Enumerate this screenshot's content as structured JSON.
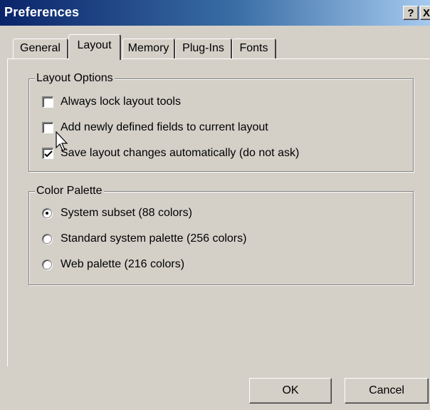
{
  "window": {
    "title": "Preferences",
    "help_button": "?",
    "close_button": "X"
  },
  "tabs": [
    {
      "label": "General",
      "active": false
    },
    {
      "label": "Layout",
      "active": true
    },
    {
      "label": "Memory",
      "active": false
    },
    {
      "label": "Plug-Ins",
      "active": false
    },
    {
      "label": "Fonts",
      "active": false
    }
  ],
  "layout_options": {
    "legend": "Layout Options",
    "items": [
      {
        "label": "Always lock layout tools",
        "checked": false
      },
      {
        "label": "Add newly defined fields to current layout",
        "checked": false
      },
      {
        "label": "Save layout changes automatically (do not ask)",
        "checked": true
      }
    ]
  },
  "color_palette": {
    "legend": "Color Palette",
    "items": [
      {
        "label": "System subset (88 colors)",
        "selected": true
      },
      {
        "label": "Standard system palette (256 colors)",
        "selected": false
      },
      {
        "label": "Web palette (216 colors)",
        "selected": false
      }
    ]
  },
  "buttons": {
    "ok": "OK",
    "cancel": "Cancel"
  },
  "icons": {
    "checkmark": "checkmark-icon",
    "cursor": "mouse-pointer-icon"
  },
  "colors": {
    "titlebar_start": "#0a246a",
    "titlebar_end": "#a6caf0",
    "face": "#d4d0c8"
  }
}
